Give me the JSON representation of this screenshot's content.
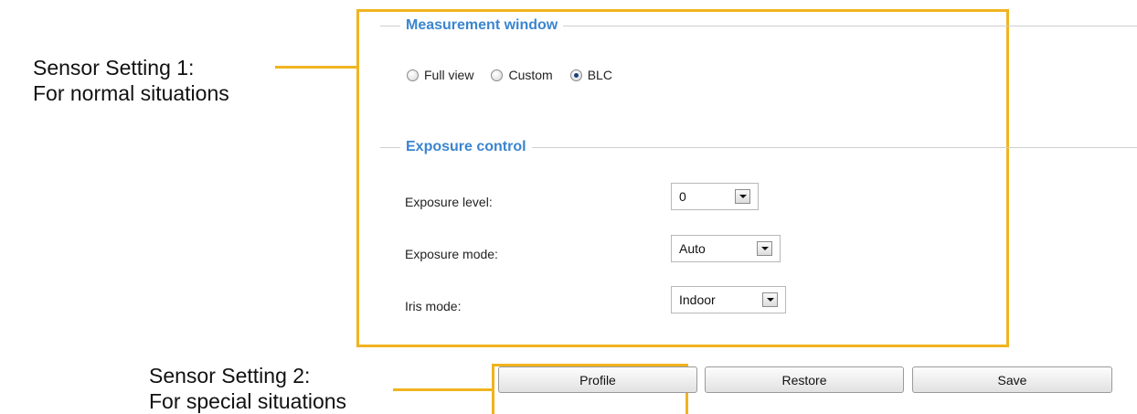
{
  "annotations": {
    "sensor1_line1": "Sensor Setting 1:",
    "sensor1_line2": "For normal situations",
    "sensor2_line1": "Sensor Setting 2:",
    "sensor2_line2": "For special situations"
  },
  "measurement": {
    "title": "Measurement window",
    "options": [
      {
        "label": "Full view",
        "checked": false
      },
      {
        "label": "Custom",
        "checked": false
      },
      {
        "label": "BLC",
        "checked": true
      }
    ]
  },
  "exposure": {
    "title": "Exposure control",
    "level": {
      "label": "Exposure level:",
      "value": "0"
    },
    "mode": {
      "label": "Exposure mode:",
      "value": "Auto"
    },
    "iris": {
      "label": "Iris mode:",
      "value": "Indoor"
    }
  },
  "buttons": {
    "profile": "Profile",
    "restore": "Restore",
    "save": "Save"
  },
  "colors": {
    "highlight": "#f0b41e",
    "fieldset_title": "#3a85cf"
  }
}
